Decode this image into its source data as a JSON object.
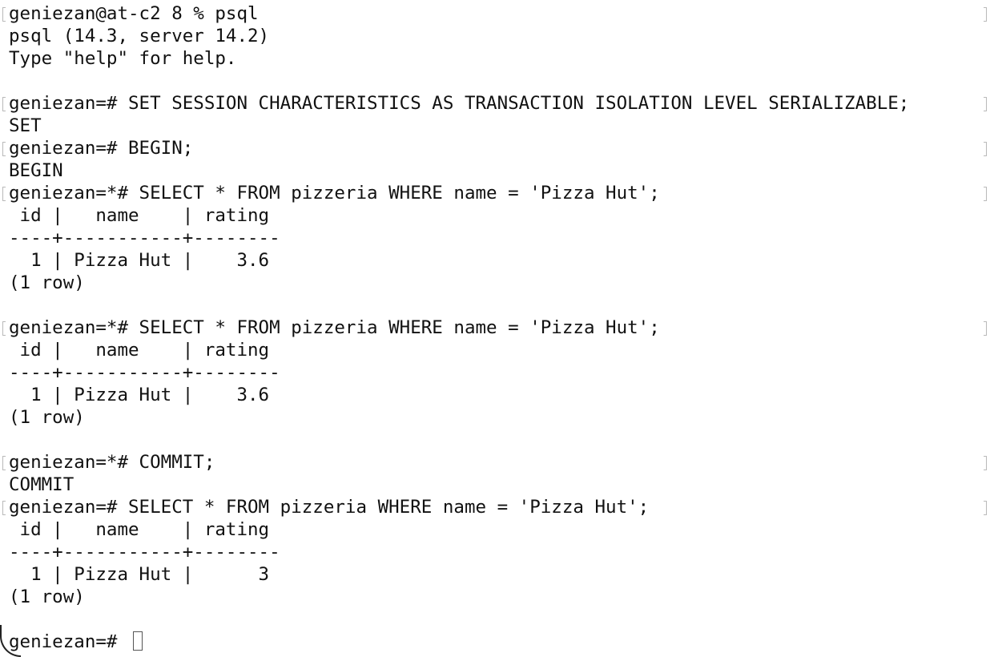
{
  "terminal": {
    "lines": [
      "geniezan@at-c2 8 % psql",
      "psql (14.3, server 14.2)",
      "Type \"help\" for help.",
      "",
      "geniezan=# SET SESSION CHARACTERISTICS AS TRANSACTION ISOLATION LEVEL SERIALIZABLE;",
      "SET",
      "geniezan=# BEGIN;",
      "BEGIN",
      "geniezan=*# SELECT * FROM pizzeria WHERE name = 'Pizza Hut';",
      " id |   name    | rating",
      "----+-----------+--------",
      "  1 | Pizza Hut |    3.6",
      "(1 row)",
      "",
      "geniezan=*# SELECT * FROM pizzeria WHERE name = 'Pizza Hut';",
      " id |   name    | rating",
      "----+-----------+--------",
      "  1 | Pizza Hut |    3.6",
      "(1 row)",
      "",
      "geniezan=*# COMMIT;",
      "COMMIT",
      "geniezan=# SELECT * FROM pizzeria WHERE name = 'Pizza Hut';",
      " id |   name    | rating",
      "----+-----------+--------",
      "  1 | Pizza Hut |      3",
      "(1 row)",
      "",
      "geniezan=# "
    ],
    "prompt_line_numbers": [
      1,
      5,
      7,
      9,
      15,
      21,
      23
    ]
  }
}
